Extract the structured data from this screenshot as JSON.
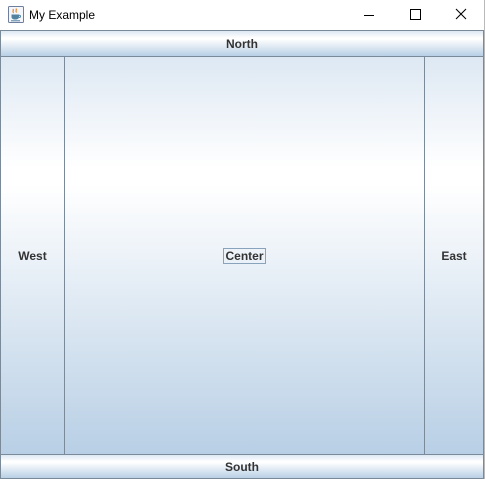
{
  "window": {
    "title": "My Example",
    "icon": "java-cup-icon",
    "controls": {
      "minimize_icon": "minimize-icon",
      "maximize_icon": "maximize-icon",
      "close_icon": "close-icon"
    }
  },
  "buttons": {
    "north": "North",
    "south": "South",
    "west": "West",
    "east": "East",
    "center": "Center"
  },
  "colors": {
    "button_border": "#7a8a99",
    "button_gradient_top": "#dde8f3",
    "button_gradient_highlight": "#ffffff",
    "button_gradient_bottom": "#b8cfe5",
    "focus_border": "#8aa3bd",
    "text": "#333333"
  }
}
